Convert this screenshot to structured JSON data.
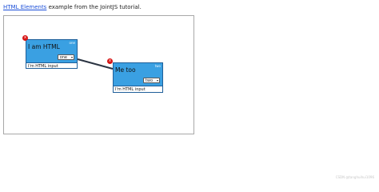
{
  "intro": {
    "link_text": "HTML Elements",
    "rest_text": " example from the JointJS tutorial."
  },
  "nodes": [
    {
      "title": "I am HTML",
      "tag": "one",
      "select_value": "one",
      "input_label": "I'm HTML input",
      "delete_label": "x"
    },
    {
      "title": "Me too",
      "tag": "two",
      "select_value": "two",
      "input_label": "I'm HTML input",
      "delete_label": "x"
    }
  ],
  "link": {
    "color": "#2b3442"
  },
  "colors": {
    "node_header": "#3aa0e2",
    "node_border": "#1f5f99",
    "delete_button": "#d71414",
    "link_text": "#1a4ed8"
  },
  "footer": {
    "text": "CSDN @tanghuihui1096"
  }
}
